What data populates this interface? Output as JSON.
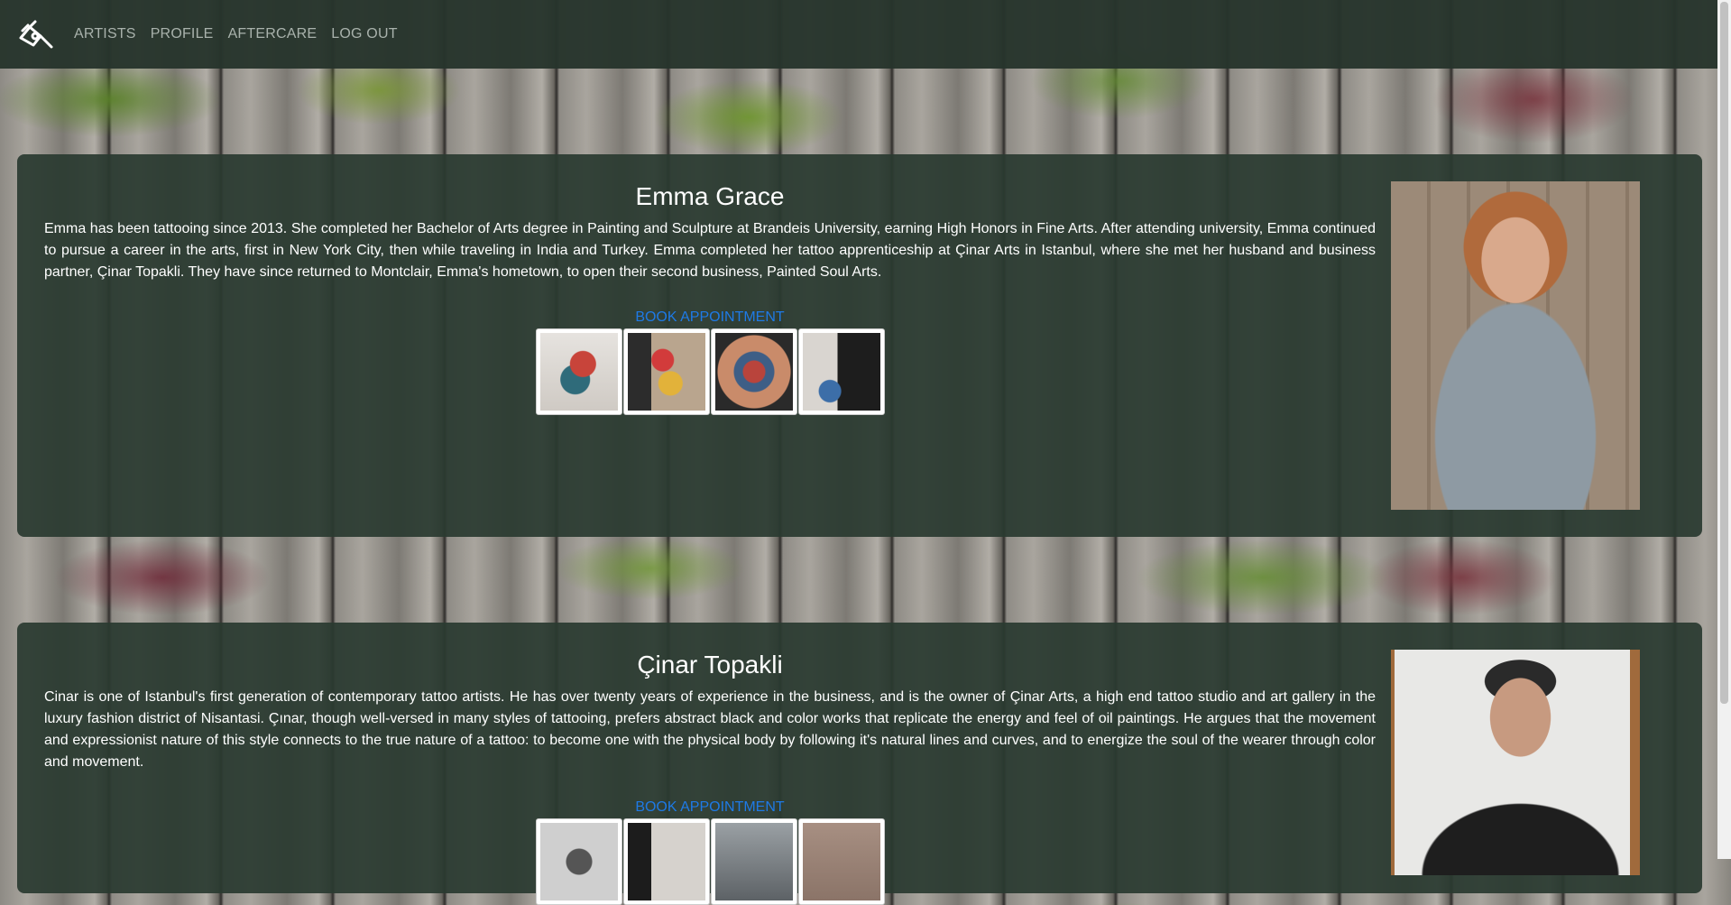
{
  "nav": {
    "logo_icon": "tattoo-machine-icon",
    "links": [
      "ARTISTS",
      "PROFILE",
      "AFTERCARE",
      "LOG OUT"
    ]
  },
  "artists": [
    {
      "name": "Emma Grace",
      "bio": "Emma has been tattooing since 2013. She completed her Bachelor of Arts degree in Painting and Sculpture at Brandeis University, earning High Honors in Fine Arts. After attending university, Emma continued to pursue a career in the arts, first in New York City, then while traveling in India and Turkey. Emma completed her tattoo apprenticeship at Çinar Arts in Istanbul, where she met her husband and business partner, Çinar Topakli. They have since returned to Montclair, Emma's hometown, to open their second business, Painted Soul Arts.",
      "book_label": "BOOK APPOINTMENT"
    },
    {
      "name": "Çinar Topakli",
      "bio": "Cinar is one of Istanbul's first generation of contemporary tattoo artists. He has over twenty years of experience in the business, and is the owner of Çinar Arts, a high end tattoo studio and art gallery in the luxury fashion district of Nisantasi. Çınar, though well-versed in many styles of tattooing, prefers abstract black and color works that replicate the energy and feel of oil paintings. He argues that the movement and expressionist nature of this style connects to the true nature of a tattoo: to become one with the physical body by following it's natural lines and curves, and to energize the soul of the wearer through color and movement.",
      "book_label": "BOOK APPOINTMENT"
    }
  ],
  "colors": {
    "nav_bg": "#26342c",
    "card_bg": "#2a3a30",
    "link_blue": "#1e7ae6",
    "nav_text": "#a9b2ac"
  }
}
